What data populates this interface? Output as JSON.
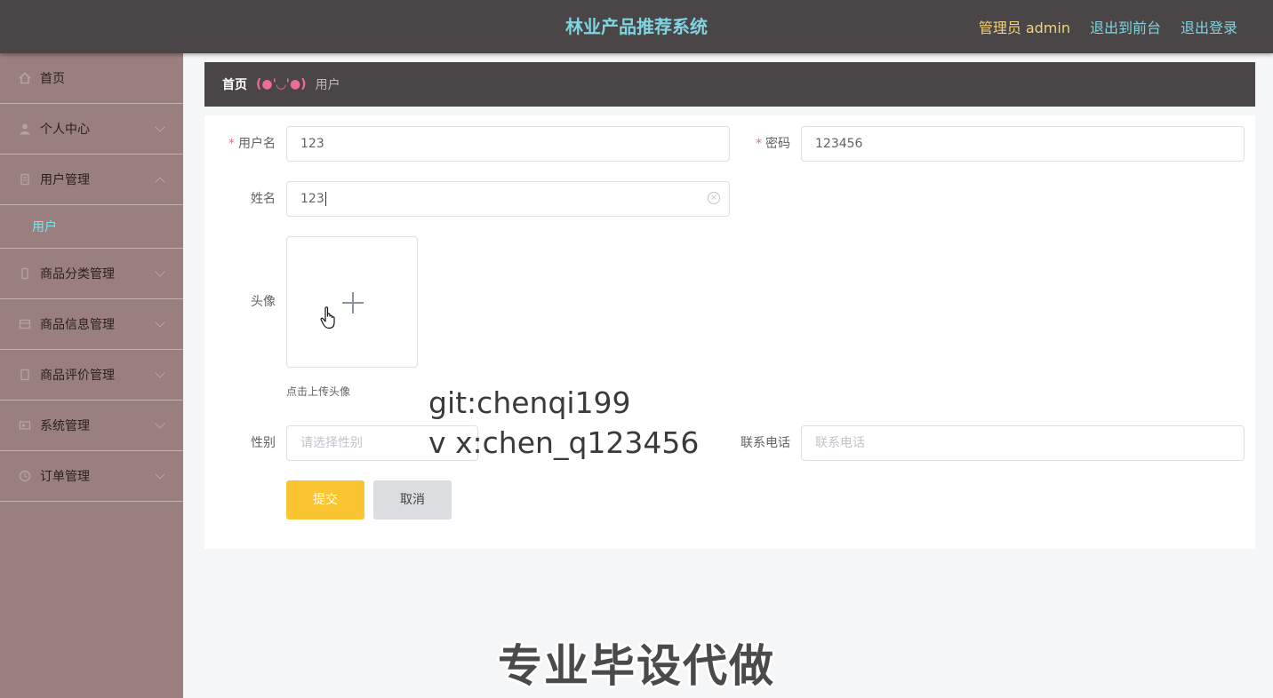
{
  "header": {
    "title": "林业产品推荐系统",
    "admin_role": "管理员",
    "admin_name": "admin",
    "to_front": "退出到前台",
    "logout": "退出登录"
  },
  "sidebar": {
    "items": [
      {
        "label": "首页",
        "icon": "home-icon"
      },
      {
        "label": "个人中心",
        "icon": "user-icon"
      },
      {
        "label": "用户管理",
        "icon": "users-icon",
        "submenu": [
          "用户"
        ]
      },
      {
        "label": "商品分类管理",
        "icon": "category-icon"
      },
      {
        "label": "商品信息管理",
        "icon": "goods-icon"
      },
      {
        "label": "商品评价管理",
        "icon": "comment-icon"
      },
      {
        "label": "系统管理",
        "icon": "system-icon"
      },
      {
        "label": "订单管理",
        "icon": "order-icon"
      }
    ]
  },
  "breadcrumb": {
    "home": "首页",
    "separator": "(●'◡'●)",
    "current": "用户"
  },
  "form": {
    "username": {
      "label": "用户名",
      "value": "123"
    },
    "password": {
      "label": "密码",
      "value": "123456"
    },
    "name": {
      "label": "姓名",
      "value": "123"
    },
    "avatar": {
      "label": "头像",
      "hint": "点击上传头像"
    },
    "gender": {
      "label": "性别",
      "placeholder": "请选择性别"
    },
    "phone": {
      "label": "联系电话",
      "placeholder": "联系电话"
    },
    "submit": "提交",
    "cancel": "取消"
  },
  "watermark": {
    "line1": "git:chenqi199",
    "line2": "v x:chen_q123456",
    "banner": "专业毕设代做"
  },
  "colors": {
    "topbar": "#4a4546",
    "sidebar": "#9a7f7f",
    "title": "#7fd4e0",
    "admin": "#f0d37a",
    "submit": "#fbc531",
    "required": "#f56c6c"
  }
}
